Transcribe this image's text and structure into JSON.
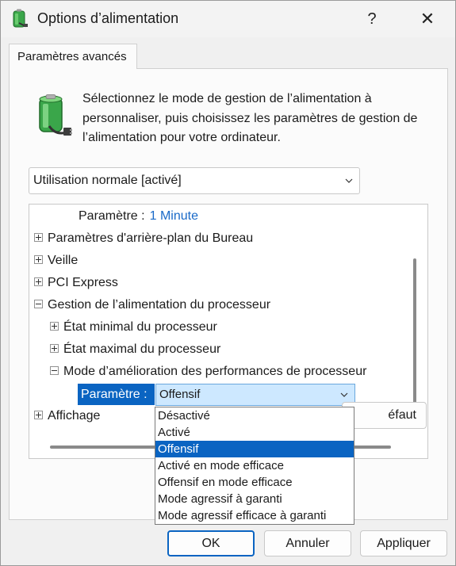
{
  "window": {
    "title": "Options d’alimentation",
    "help_label": "?",
    "close_label": "✕"
  },
  "tab": {
    "label": "Paramètres avancés"
  },
  "description": "Sélectionnez le mode de gestion de l’alimentation à personnaliser, puis choisissez les paramètres de gestion de l’alimentation pour votre ordinateur.",
  "plan_select": {
    "value": "Utilisation normale [activé]"
  },
  "tree": {
    "top_setting_label": "Paramètre :",
    "top_setting_value": "1 Minute",
    "items": [
      {
        "label": "Paramètres d'arrière-plan du Bureau",
        "expanded": false
      },
      {
        "label": "Veille",
        "expanded": false
      },
      {
        "label": "PCI Express",
        "expanded": false
      },
      {
        "label": "Gestion de l’alimentation du processeur",
        "expanded": true
      },
      {
        "label": "État minimal du processeur",
        "expanded": false
      },
      {
        "label": "État maximal du processeur",
        "expanded": false
      },
      {
        "label": "Mode d’amélioration des performances de processeur",
        "expanded": true
      },
      {
        "label": "Affichage",
        "expanded": false
      }
    ],
    "param_label": "Paramètre :",
    "param_value": "Offensif"
  },
  "dropdown": {
    "options": [
      "Désactivé",
      "Activé",
      "Offensif",
      "Activé en mode efficace",
      "Offensif en mode efficace",
      "Mode agressif à garanti",
      "Mode agressif efficace à garanti"
    ],
    "selected_index": 2
  },
  "restore_button": {
    "label_visible": "éfaut"
  },
  "footer": {
    "ok_label": "OK",
    "cancel_label": "Annuler",
    "apply_label": "Appliquer"
  },
  "colors": {
    "accent": "#0a64c2",
    "link_blue": "#1a6ac8",
    "combo_highlight": "#cde8ff"
  }
}
